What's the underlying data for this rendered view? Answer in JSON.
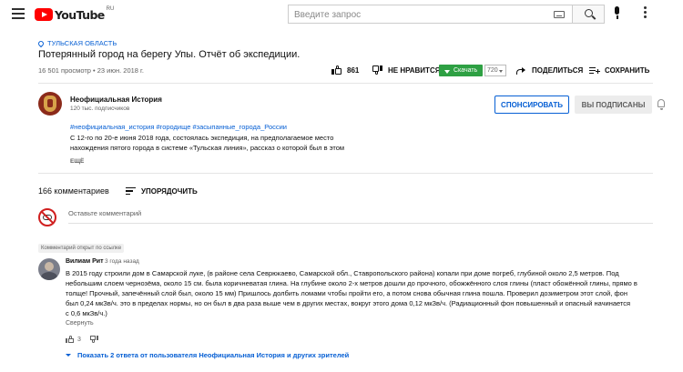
{
  "masthead": {
    "logo_text": "YouTube",
    "region": "RU",
    "search_placeholder": "Введите запрос"
  },
  "video": {
    "location": "ТУЛЬСКАЯ ОБЛАСТЬ",
    "title": "Потерянный город на берегу Упы. Отчёт об экспедиции.",
    "meta": "16 501 просмотр • 23 июн. 2018 г.",
    "likes": "861",
    "dislike_label": "НЕ НРАВИТСЯ",
    "download_label": "Скачать",
    "quality": "720",
    "share_label": "ПОДЕЛИТЬСЯ",
    "save_label": "СОХРАНИТЬ"
  },
  "channel": {
    "name": "Неофициальная История",
    "subscribers": "120 тыс. подписчиков",
    "subscribe_label": "СПОНСИРОВАТЬ",
    "subscribed_label": "ВЫ ПОДПИСАНЫ"
  },
  "description": {
    "hashtags": "#неофициальная_история #городище #засыпанные_города_России",
    "lines": [
      "С 12-го по 20-е июня 2018 года, состоялась экспедиция, на предполагаемое место",
      "нахождения пятого города в системе «Тульская линия», рассказ о которой был в этом"
    ],
    "show_more": "ЕЩЁ"
  },
  "comments": {
    "count": "166 комментариев",
    "sort_label": "УПОРЯДОЧИТЬ",
    "add_placeholder": "Оставьте комментарий",
    "highlighted_badge": "Комментарий открыт по ссылке",
    "highlighted": {
      "author": "Вилиам Рит",
      "time": "3 года назад",
      "lines": [
        "В 2015 году строили дом в Самарской луке, (в районе села Севрюкаево, Самарской обл., Ставропольского района) копали при доме погреб, глубиной около 2,5 метров. Под",
        "небольшим слоем чернозёма, около 15 см. была  коричневатая глина. На глубине около 2-х метров дошли до прочного, обожжённого слоя глины (пласт обожённой глины, прямо в",
        "толще! Прочный, запечённый слой был, около 15 мм) Пришлось долбить ломами чтобы пройти его, а потом снова обычная глина пошла. Проверил дозиметром этот слой, фон",
        "был 0,24 мкЗв/ч. это в пределах нормы, но он был в два раза выше чем в других местах, вокруг этого дома 0,12 мкЗв/ч. (Радиационный фон повышенный и опасный начинается",
        "с 0,6 мкЗв/ч.)"
      ],
      "reply_label": "Свернуть",
      "likes": "3",
      "show_replies": "Показать 2 ответа от пользователя Неофициальная История и других зрителей"
    }
  },
  "colors": {
    "brand_red": "#ff0000",
    "link_blue": "#065fd4",
    "download_green": "#2ea043"
  }
}
